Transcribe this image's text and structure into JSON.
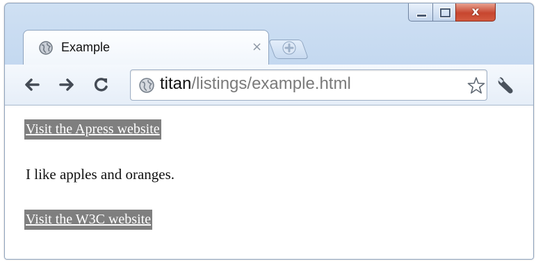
{
  "window": {
    "controls": {
      "minimize": "–",
      "maximize": "□",
      "close": "x"
    }
  },
  "tabs": [
    {
      "title": "Example",
      "close": "×",
      "favicon": "globe-icon"
    }
  ],
  "new_tab": {
    "icon": "new-tab-icon"
  },
  "toolbar": {
    "back_icon": "back-arrow-icon",
    "forward_icon": "forward-arrow-icon",
    "reload_icon": "reload-icon",
    "address": {
      "host": "titan",
      "path": "/listings/example.html",
      "icon": "globe-icon"
    },
    "bookmark_icon": "star-icon",
    "menu_icon": "wrench-icon"
  },
  "page": {
    "link1": "Visit the Apress website",
    "paragraph": "I like apples and oranges.",
    "link2": "Visit the W3C website",
    "highlight_color": "#7f7f7f"
  }
}
